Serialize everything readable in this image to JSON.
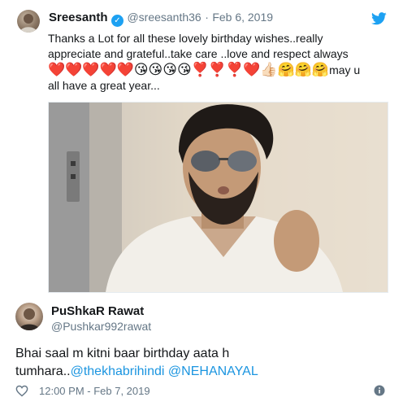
{
  "tweet": {
    "display_name": "Sreesanth",
    "handle": "@sreesanth36",
    "separator": "·",
    "date": "Feb 6, 2019",
    "line1": "Thanks a Lot for all these lovely birthday wishes..really",
    "line2": "appreciate and grateful..take care ..love and respect always",
    "emojis": "❤️❤️❤️❤️❤️😘😘😘😘❣️❣️❣️❤️👍🏻🤗🤗🤗",
    "emoji_tail": "may u",
    "line4": "all have a great year..."
  },
  "reply": {
    "display_name": "PuShkaR Rawat",
    "handle": "@Pushkar992rawat",
    "line1": "Bhai saal m kitni baar birthday aata h",
    "line2_text": "tumhara..",
    "mention1": "@thekhabrihindi",
    "mention2": "@NEHANAYAL",
    "time": "12:00 PM - Feb 7, 2019"
  },
  "colors": {
    "twitter_blue": "#1da1f2",
    "link": "#1b95e0",
    "heart_red": "#e0245e",
    "muted": "#657786"
  },
  "icons": {
    "bird": "twitter-bird-icon",
    "verified": "verified-badge-icon",
    "like": "heart-icon",
    "info": "info-icon"
  }
}
